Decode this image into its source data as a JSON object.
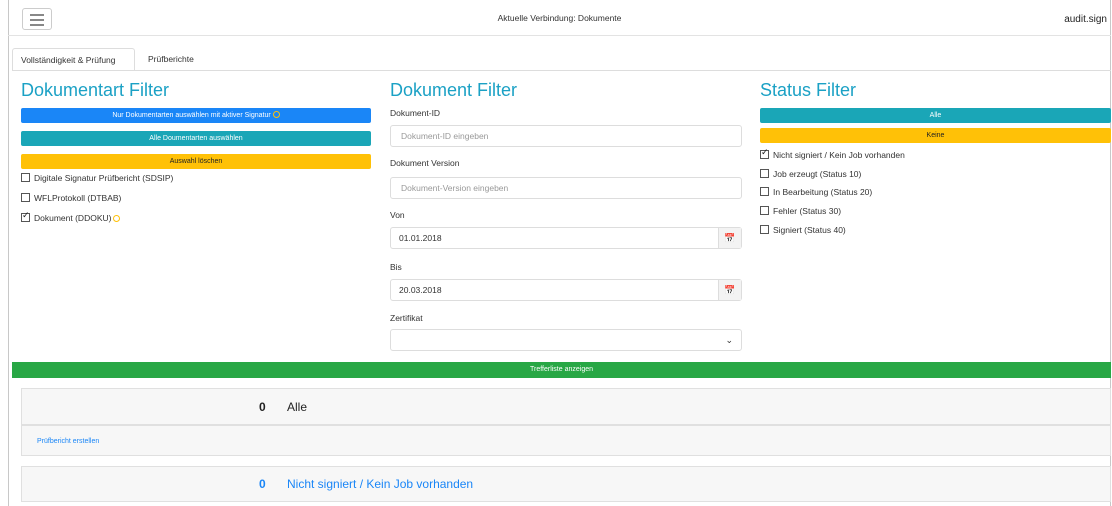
{
  "header": {
    "menu_icon": "hamburger-icon",
    "connection": "Aktuelle Verbindung: Dokumente",
    "brand": "audit.sign"
  },
  "tabs": [
    {
      "label": "Vollständigkeit & Prüfung",
      "active": true
    },
    {
      "label": "Prüfberichte",
      "active": false
    }
  ],
  "doc_type_filter": {
    "title": "Dokumentart Filter",
    "btn_active_signature": "Nur Dokumentarten auswählen mit aktiver Signatur",
    "btn_select_all": "Alle Doumentarten auswählen",
    "btn_clear": "Auswahl löschen",
    "items": [
      {
        "label": "Digitale Signatur Prüfbericht (SDSIP)",
        "checked": false
      },
      {
        "label": "WFLProtokoll (DTBAB)",
        "checked": false
      },
      {
        "label": "Dokument (DDOKU)",
        "checked": true,
        "badge": "medal-icon"
      }
    ]
  },
  "document_filter": {
    "title": "Dokument Filter",
    "doc_id_label": "Dokument-ID",
    "doc_id_placeholder": "Dokument-ID eingeben",
    "doc_version_label": "Dokument Version",
    "doc_version_placeholder": "Dokument-Version eingeben",
    "from_label": "Von",
    "from_value": "01.01.2018",
    "to_label": "Bis",
    "to_value": "20.03.2018",
    "cert_label": "Zertifikat",
    "cert_value": "",
    "calendar_icon": "calendar-icon"
  },
  "status_filter": {
    "title": "Status Filter",
    "btn_all": "Alle",
    "btn_none": "Keine",
    "items": [
      {
        "label": "Nicht signiert / Kein Job vorhanden",
        "checked": true
      },
      {
        "label": "Job erzeugt (Status 10)",
        "checked": false
      },
      {
        "label": "In Bearbeitung (Status 20)",
        "checked": false
      },
      {
        "label": "Fehler (Status 30)",
        "checked": false
      },
      {
        "label": "Signiert (Status 40)",
        "checked": false
      }
    ]
  },
  "show_results_button": "Trefferliste anzeigen",
  "results": [
    {
      "count": "0",
      "title": "Alle",
      "action": "Prüfbericht erstellen"
    },
    {
      "count": "0",
      "title": "Nicht signiert / Kein Job vorhanden"
    }
  ],
  "colors": {
    "accent": "#1ba1c5",
    "primary": "#1a86f7",
    "info": "#1aa6b7",
    "warning": "#ffc107",
    "success": "#28a745"
  }
}
